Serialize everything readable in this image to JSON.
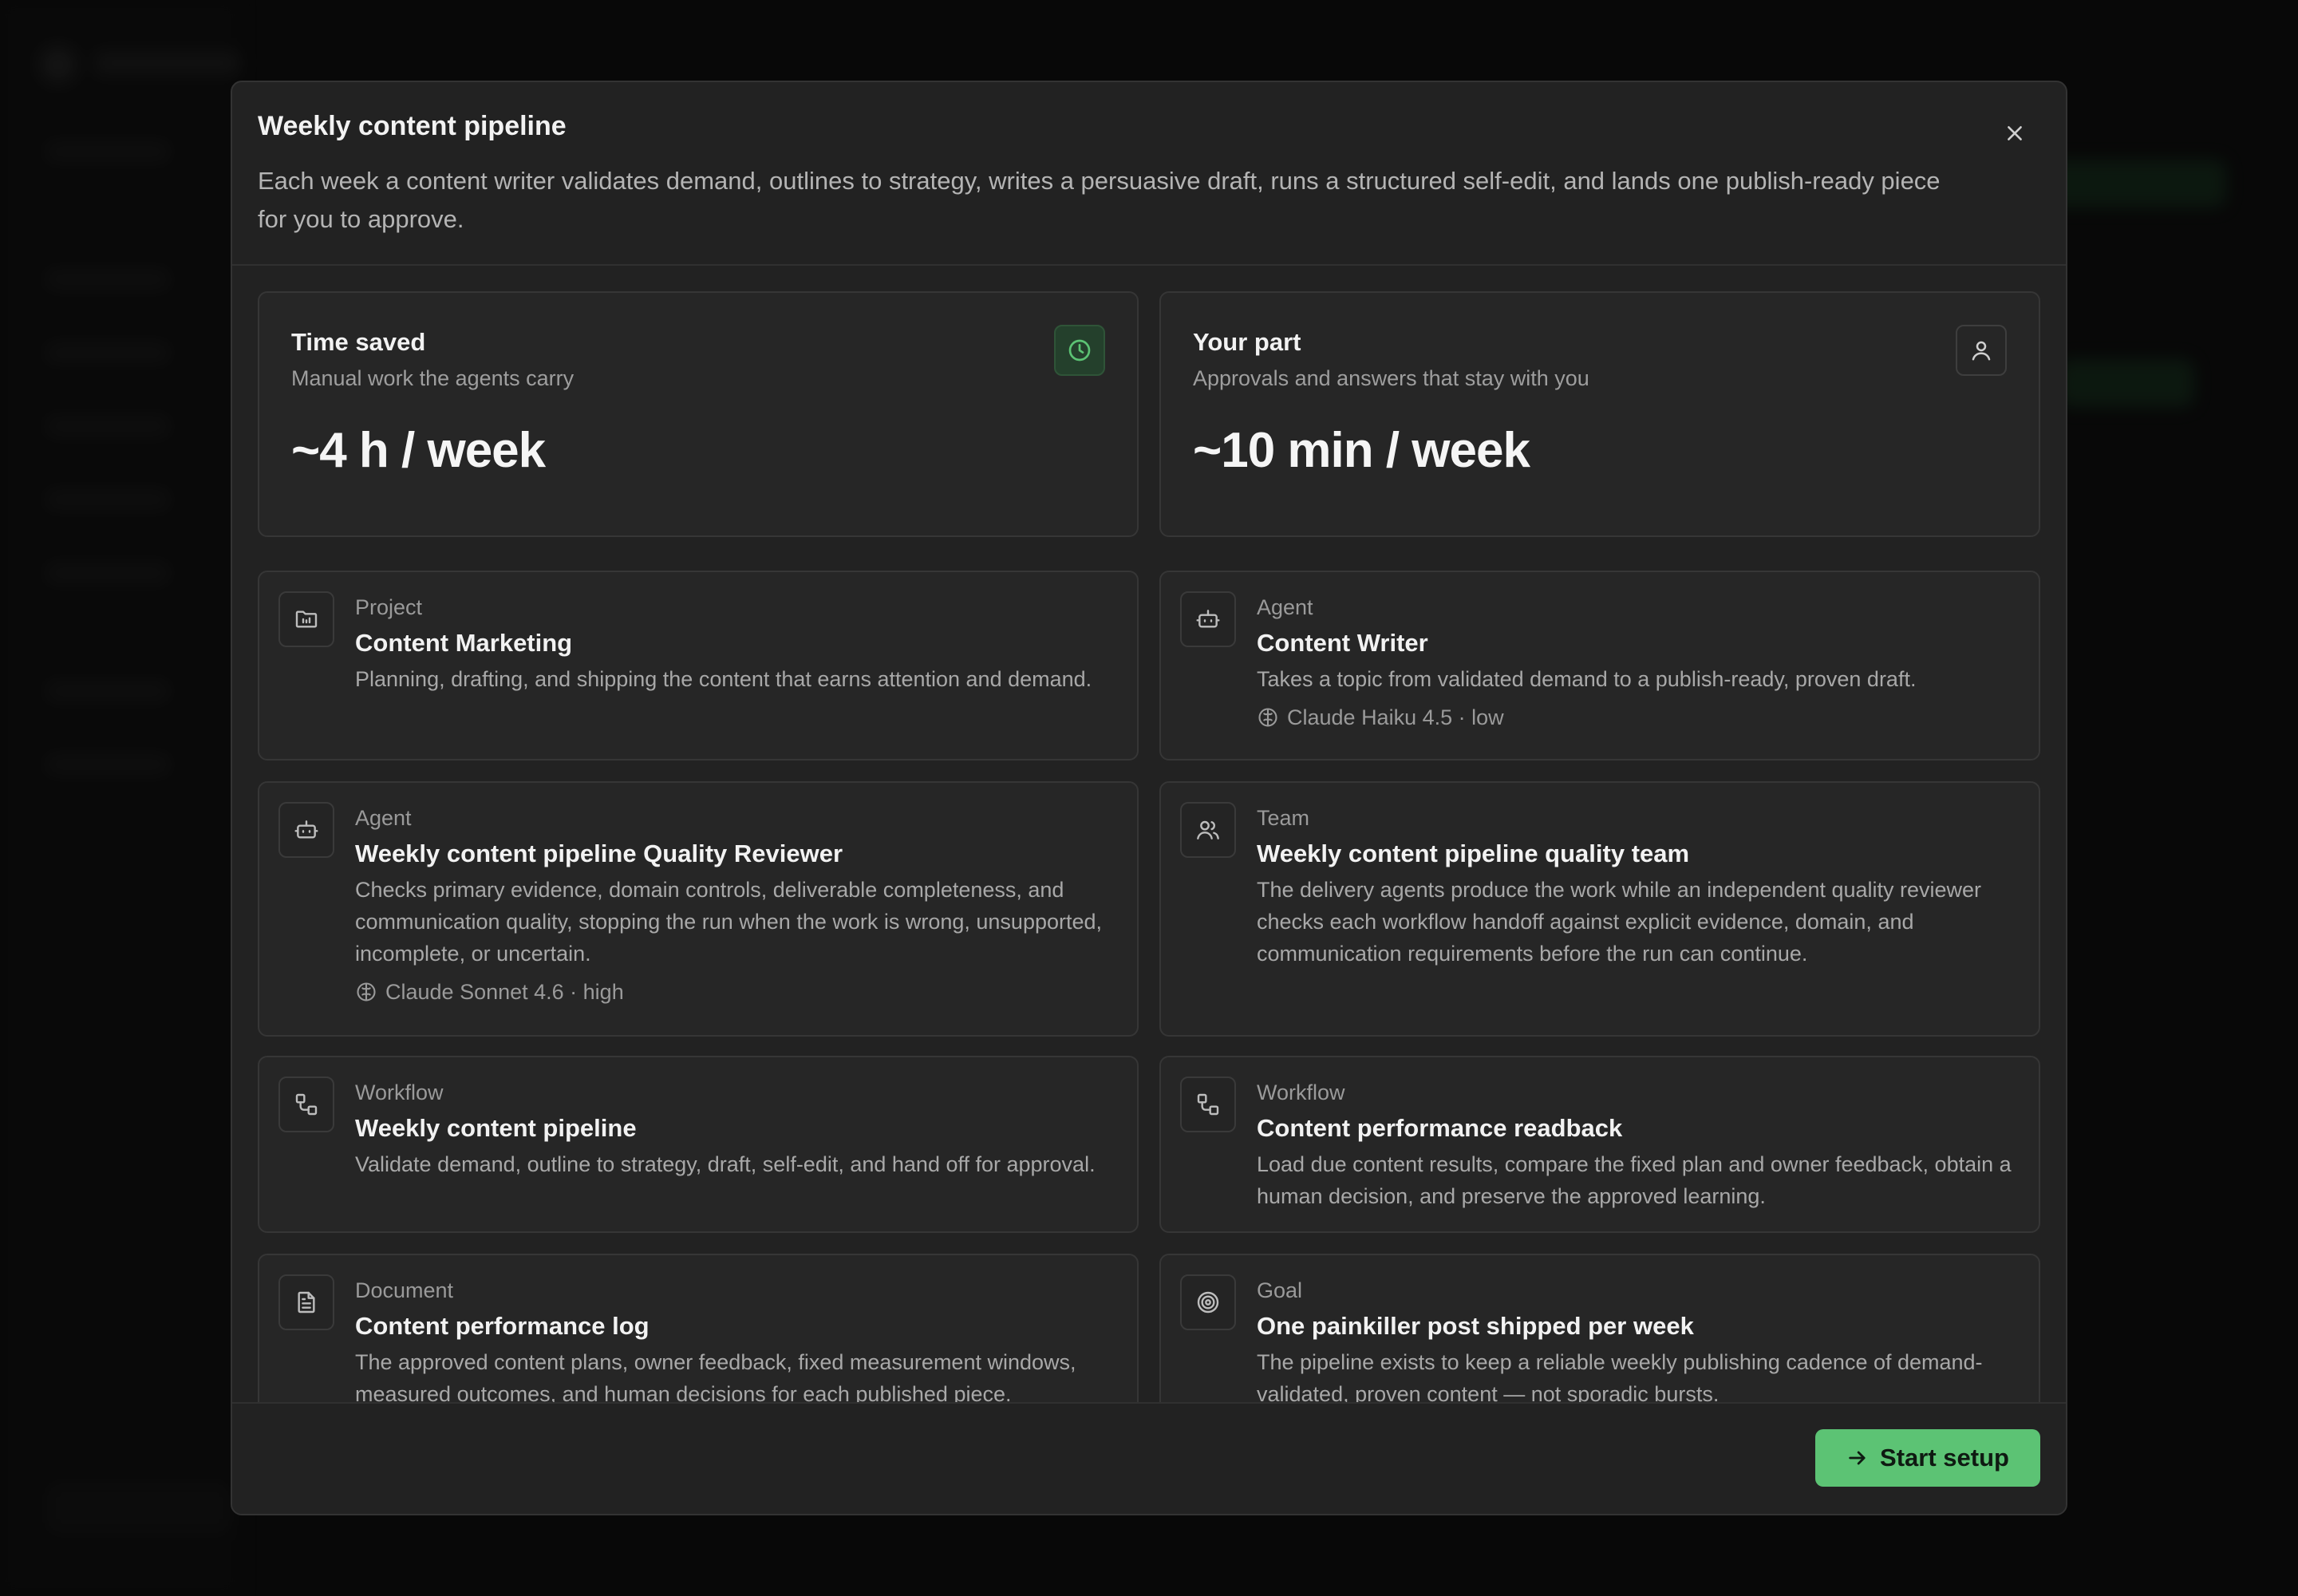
{
  "modal": {
    "title": "Weekly content pipeline",
    "description": "Each week a content writer validates demand, outlines to strategy, writes a persuasive draft, runs a structured self-edit, and lands one publish-ready piece for you to approve.",
    "close_icon": "close-icon"
  },
  "stats": [
    {
      "title": "Time saved",
      "subtitle": "Manual work the agents carry",
      "value": "~4 h / week",
      "icon": "clock-icon"
    },
    {
      "title": "Your part",
      "subtitle": "Approvals and answers that stay with you",
      "value": "~10 min / week",
      "icon": "user-icon"
    }
  ],
  "items": [
    {
      "kind": "Project",
      "name": "Content Marketing",
      "description": "Planning, drafting, and shipping the content that earns attention and demand.",
      "icon": "folder-icon"
    },
    {
      "kind": "Agent",
      "name": "Content Writer",
      "description": "Takes a topic from validated demand to a publish-ready, proven draft.",
      "model": "Claude Haiku 4.5 · low",
      "icon": "bot-icon"
    },
    {
      "kind": "Agent",
      "name": "Weekly content pipeline Quality Reviewer",
      "description": "Checks primary evidence, domain controls, deliverable completeness, and communication quality, stopping the run when the work is wrong, unsupported, incomplete, or uncertain.",
      "model": "Claude Sonnet 4.6 · high",
      "icon": "bot-icon"
    },
    {
      "kind": "Team",
      "name": "Weekly content pipeline quality team",
      "description": "The delivery agents produce the work while an independent quality reviewer checks each workflow handoff against explicit evidence, domain, and communication requirements before the run can continue.",
      "icon": "users-icon"
    },
    {
      "kind": "Workflow",
      "name": "Weekly content pipeline",
      "description": "Validate demand, outline to strategy, draft, self-edit, and hand off for approval.",
      "icon": "workflow-icon"
    },
    {
      "kind": "Workflow",
      "name": "Content performance readback",
      "description": "Load due content results, compare the fixed plan and owner feedback, obtain a human decision, and preserve the approved learning.",
      "icon": "workflow-icon"
    },
    {
      "kind": "Document",
      "name": "Content performance log",
      "description": "The approved content plans, owner feedback, fixed measurement windows, measured outcomes, and human decisions for each published piece.",
      "icon": "document-icon"
    },
    {
      "kind": "Goal",
      "name": "One painkiller post shipped per week",
      "description": "The pipeline exists to keep a reliable weekly publishing cadence of demand-validated, proven content — not sporadic bursts.",
      "icon": "target-icon"
    }
  ],
  "footer": {
    "start_label": "Start setup",
    "start_icon": "arrow-right-icon"
  },
  "colors": {
    "accent": "#5cc374",
    "modal_bg": "#222222",
    "card_bg": "#262626"
  }
}
